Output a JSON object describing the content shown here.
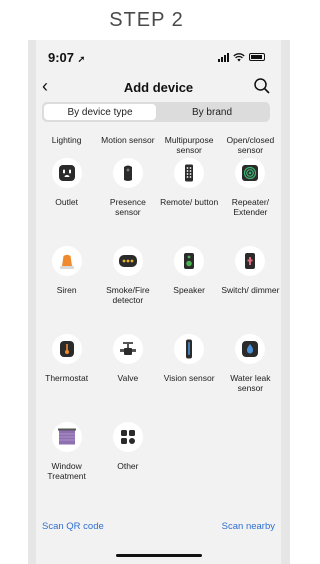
{
  "step_label": "STEP 2",
  "status": {
    "time": "9:07",
    "location_glyph": "➚"
  },
  "nav": {
    "title": "Add device",
    "back_glyph": "‹"
  },
  "segments": [
    {
      "label": "By device type",
      "active": true
    },
    {
      "label": "By brand",
      "active": false
    }
  ],
  "top_row_labels": [
    "Lighting",
    "Motion sensor",
    "Multipurpose sensor",
    "Open/closed sensor"
  ],
  "devices": [
    {
      "label": "Outlet",
      "icon": "outlet-icon"
    },
    {
      "label": "Presence sensor",
      "icon": "presence-sensor-icon"
    },
    {
      "label": "Remote/ button",
      "icon": "remote-icon"
    },
    {
      "label": "Repeater/ Extender",
      "icon": "repeater-icon"
    },
    {
      "label": "Siren",
      "icon": "siren-icon"
    },
    {
      "label": "Smoke/Fire detector",
      "icon": "smoke-detector-icon"
    },
    {
      "label": "Speaker",
      "icon": "speaker-icon"
    },
    {
      "label": "Switch/ dimmer",
      "icon": "switch-icon"
    },
    {
      "label": "Thermostat",
      "icon": "thermostat-icon"
    },
    {
      "label": "Valve",
      "icon": "valve-icon"
    },
    {
      "label": "Vision sensor",
      "icon": "vision-sensor-icon"
    },
    {
      "label": "Water leak sensor",
      "icon": "water-leak-icon"
    },
    {
      "label": "Window Treatment",
      "icon": "window-treatment-icon"
    },
    {
      "label": "Other",
      "icon": "other-icon"
    }
  ],
  "bottom": {
    "scan_qr": "Scan QR code",
    "scan_nearby": "Scan nearby"
  },
  "colors": {
    "link": "#2f6fd1",
    "icon_dark": "#2b2b2b",
    "siren": "#f08a2c",
    "speaker": "#4caf50",
    "repeater": "#3cb371",
    "window": "#8e6fb0"
  }
}
